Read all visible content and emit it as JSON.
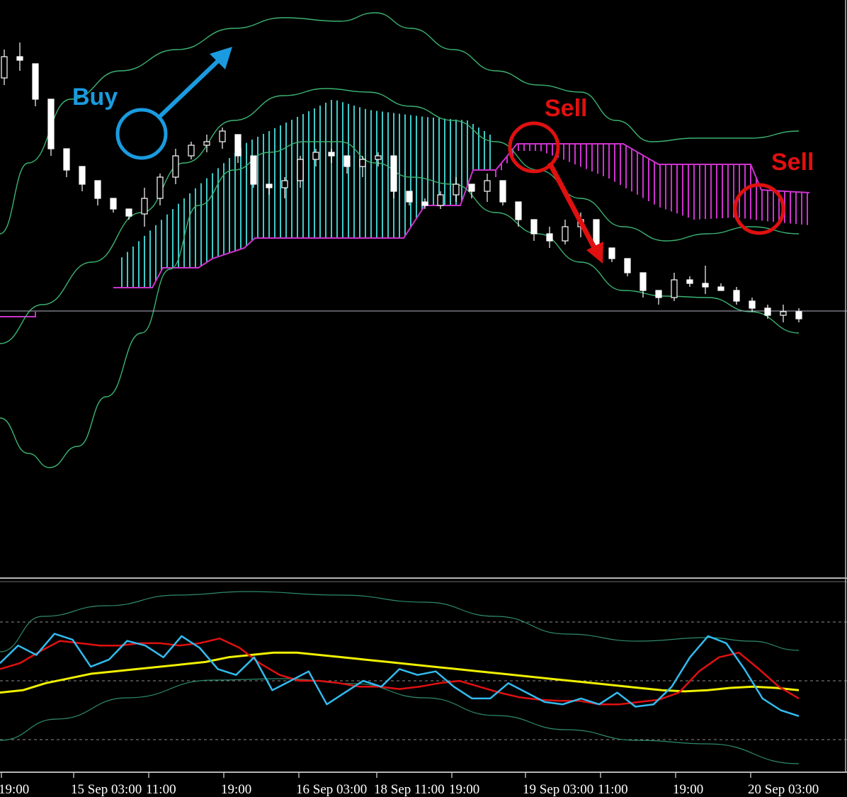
{
  "colors": {
    "background": "#000000",
    "candle": "#ffffff",
    "bollinger": "#3cb371",
    "cloud_bull": "#40c8c8",
    "cloud_bear": "#cc33cc",
    "cloud_edge": "#cc33cc",
    "price_line": "#b4b4c8",
    "osc_fast": "#33bbee",
    "osc_slow": "#e01010",
    "osc_trend": "#f0f000",
    "osc_band": "#2e8b6e",
    "level_line": "#8c8c8c",
    "buy": "#1a9be0",
    "sell": "#e01010",
    "tick_text": "#ffffff"
  },
  "time_axis": {
    "ticks": [
      "19:00",
      "15 Sep 03:00",
      "11:00",
      "19:00",
      "16 Sep 03:00",
      "18 Sep 11:00",
      "19:00",
      "19 Sep 03:00",
      "11:00",
      "19:00",
      "20 Sep 03:00"
    ]
  },
  "annotations": {
    "buy_label": "Buy",
    "sell_label_1": "Sell",
    "sell_label_2": "Sell"
  },
  "chart_data": [
    {
      "type": "candlestick",
      "panel": "price",
      "indicators": [
        "Bollinger Bands",
        "Ichimoku cloud"
      ],
      "candles_o_h_l_c": [
        [
          350,
          390,
          340,
          380
        ],
        [
          380,
          400,
          360,
          375
        ],
        [
          370,
          350,
          310,
          320
        ],
        [
          320,
          300,
          240,
          250
        ],
        [
          250,
          230,
          210,
          220
        ],
        [
          225,
          215,
          190,
          200
        ],
        [
          205,
          190,
          170,
          180
        ],
        [
          180,
          175,
          160,
          165
        ],
        [
          165,
          160,
          150,
          155
        ],
        [
          158,
          195,
          140,
          180
        ],
        [
          180,
          215,
          170,
          210
        ],
        [
          210,
          250,
          200,
          240
        ],
        [
          240,
          260,
          235,
          255
        ],
        [
          255,
          270,
          245,
          260
        ],
        [
          260,
          280,
          250,
          275
        ],
        [
          270,
          265,
          230,
          240
        ],
        [
          240,
          210,
          195,
          200
        ],
        [
          200,
          200,
          185,
          195
        ],
        [
          195,
          210,
          180,
          205
        ],
        [
          205,
          240,
          195,
          235
        ],
        [
          235,
          250,
          225,
          245
        ],
        [
          245,
          250,
          230,
          240
        ],
        [
          240,
          230,
          215,
          225
        ],
        [
          225,
          240,
          210,
          235
        ],
        [
          235,
          245,
          225,
          240
        ],
        [
          240,
          200,
          180,
          190
        ],
        [
          190,
          180,
          170,
          175
        ],
        [
          175,
          180,
          165,
          170
        ],
        [
          170,
          190,
          165,
          185
        ],
        [
          185,
          210,
          175,
          200
        ],
        [
          200,
          195,
          180,
          190
        ],
        [
          190,
          215,
          175,
          205
        ],
        [
          205,
          180,
          170,
          175
        ],
        [
          175,
          160,
          140,
          150
        ],
        [
          150,
          140,
          120,
          130
        ],
        [
          130,
          140,
          110,
          120
        ],
        [
          120,
          150,
          115,
          140
        ],
        [
          140,
          160,
          125,
          150
        ],
        [
          150,
          145,
          100,
          110
        ],
        [
          110,
          100,
          90,
          95
        ],
        [
          95,
          90,
          70,
          75
        ],
        [
          75,
          60,
          40,
          50
        ],
        [
          50,
          45,
          30,
          40
        ],
        [
          40,
          75,
          35,
          65
        ],
        [
          65,
          70,
          55,
          60
        ],
        [
          60,
          85,
          45,
          55
        ],
        [
          55,
          60,
          50,
          50
        ],
        [
          50,
          55,
          30,
          35
        ],
        [
          35,
          40,
          20,
          25
        ],
        [
          25,
          30,
          10,
          15
        ],
        [
          15,
          30,
          5,
          20
        ],
        [
          20,
          25,
          5,
          10
        ]
      ]
    },
    {
      "type": "line",
      "panel": "oscillator",
      "series": [
        {
          "color_key": "osc_fast",
          "values": [
            65,
            80,
            72,
            90,
            85,
            62,
            68,
            84,
            80,
            70,
            88,
            78,
            60,
            55,
            70,
            42,
            50,
            58,
            30,
            40,
            50,
            45,
            60,
            55,
            58,
            45,
            35,
            35,
            48,
            40,
            32,
            30,
            35,
            30,
            40,
            28,
            30,
            45,
            70,
            88,
            82,
            60,
            35,
            25,
            20
          ]
        },
        {
          "color_key": "osc_slow",
          "values": [
            60,
            65,
            75,
            84,
            82,
            80,
            80,
            82,
            82,
            80,
            82,
            86,
            78,
            65,
            55,
            50,
            50,
            48,
            45,
            45,
            43,
            45,
            48,
            50,
            45,
            40,
            36,
            34,
            33,
            33,
            30,
            30,
            32,
            34,
            40,
            58,
            70,
            74,
            60,
            45,
            35
          ]
        },
        {
          "color_key": "osc_trend",
          "values": [
            40,
            42,
            48,
            52,
            56,
            58,
            60,
            62,
            64,
            66,
            70,
            72,
            74,
            74,
            72,
            70,
            68,
            66,
            64,
            62,
            60,
            58,
            56,
            54,
            52,
            50,
            48,
            46,
            44,
            42,
            41,
            42,
            44,
            45,
            44,
            42
          ]
        }
      ]
    }
  ]
}
